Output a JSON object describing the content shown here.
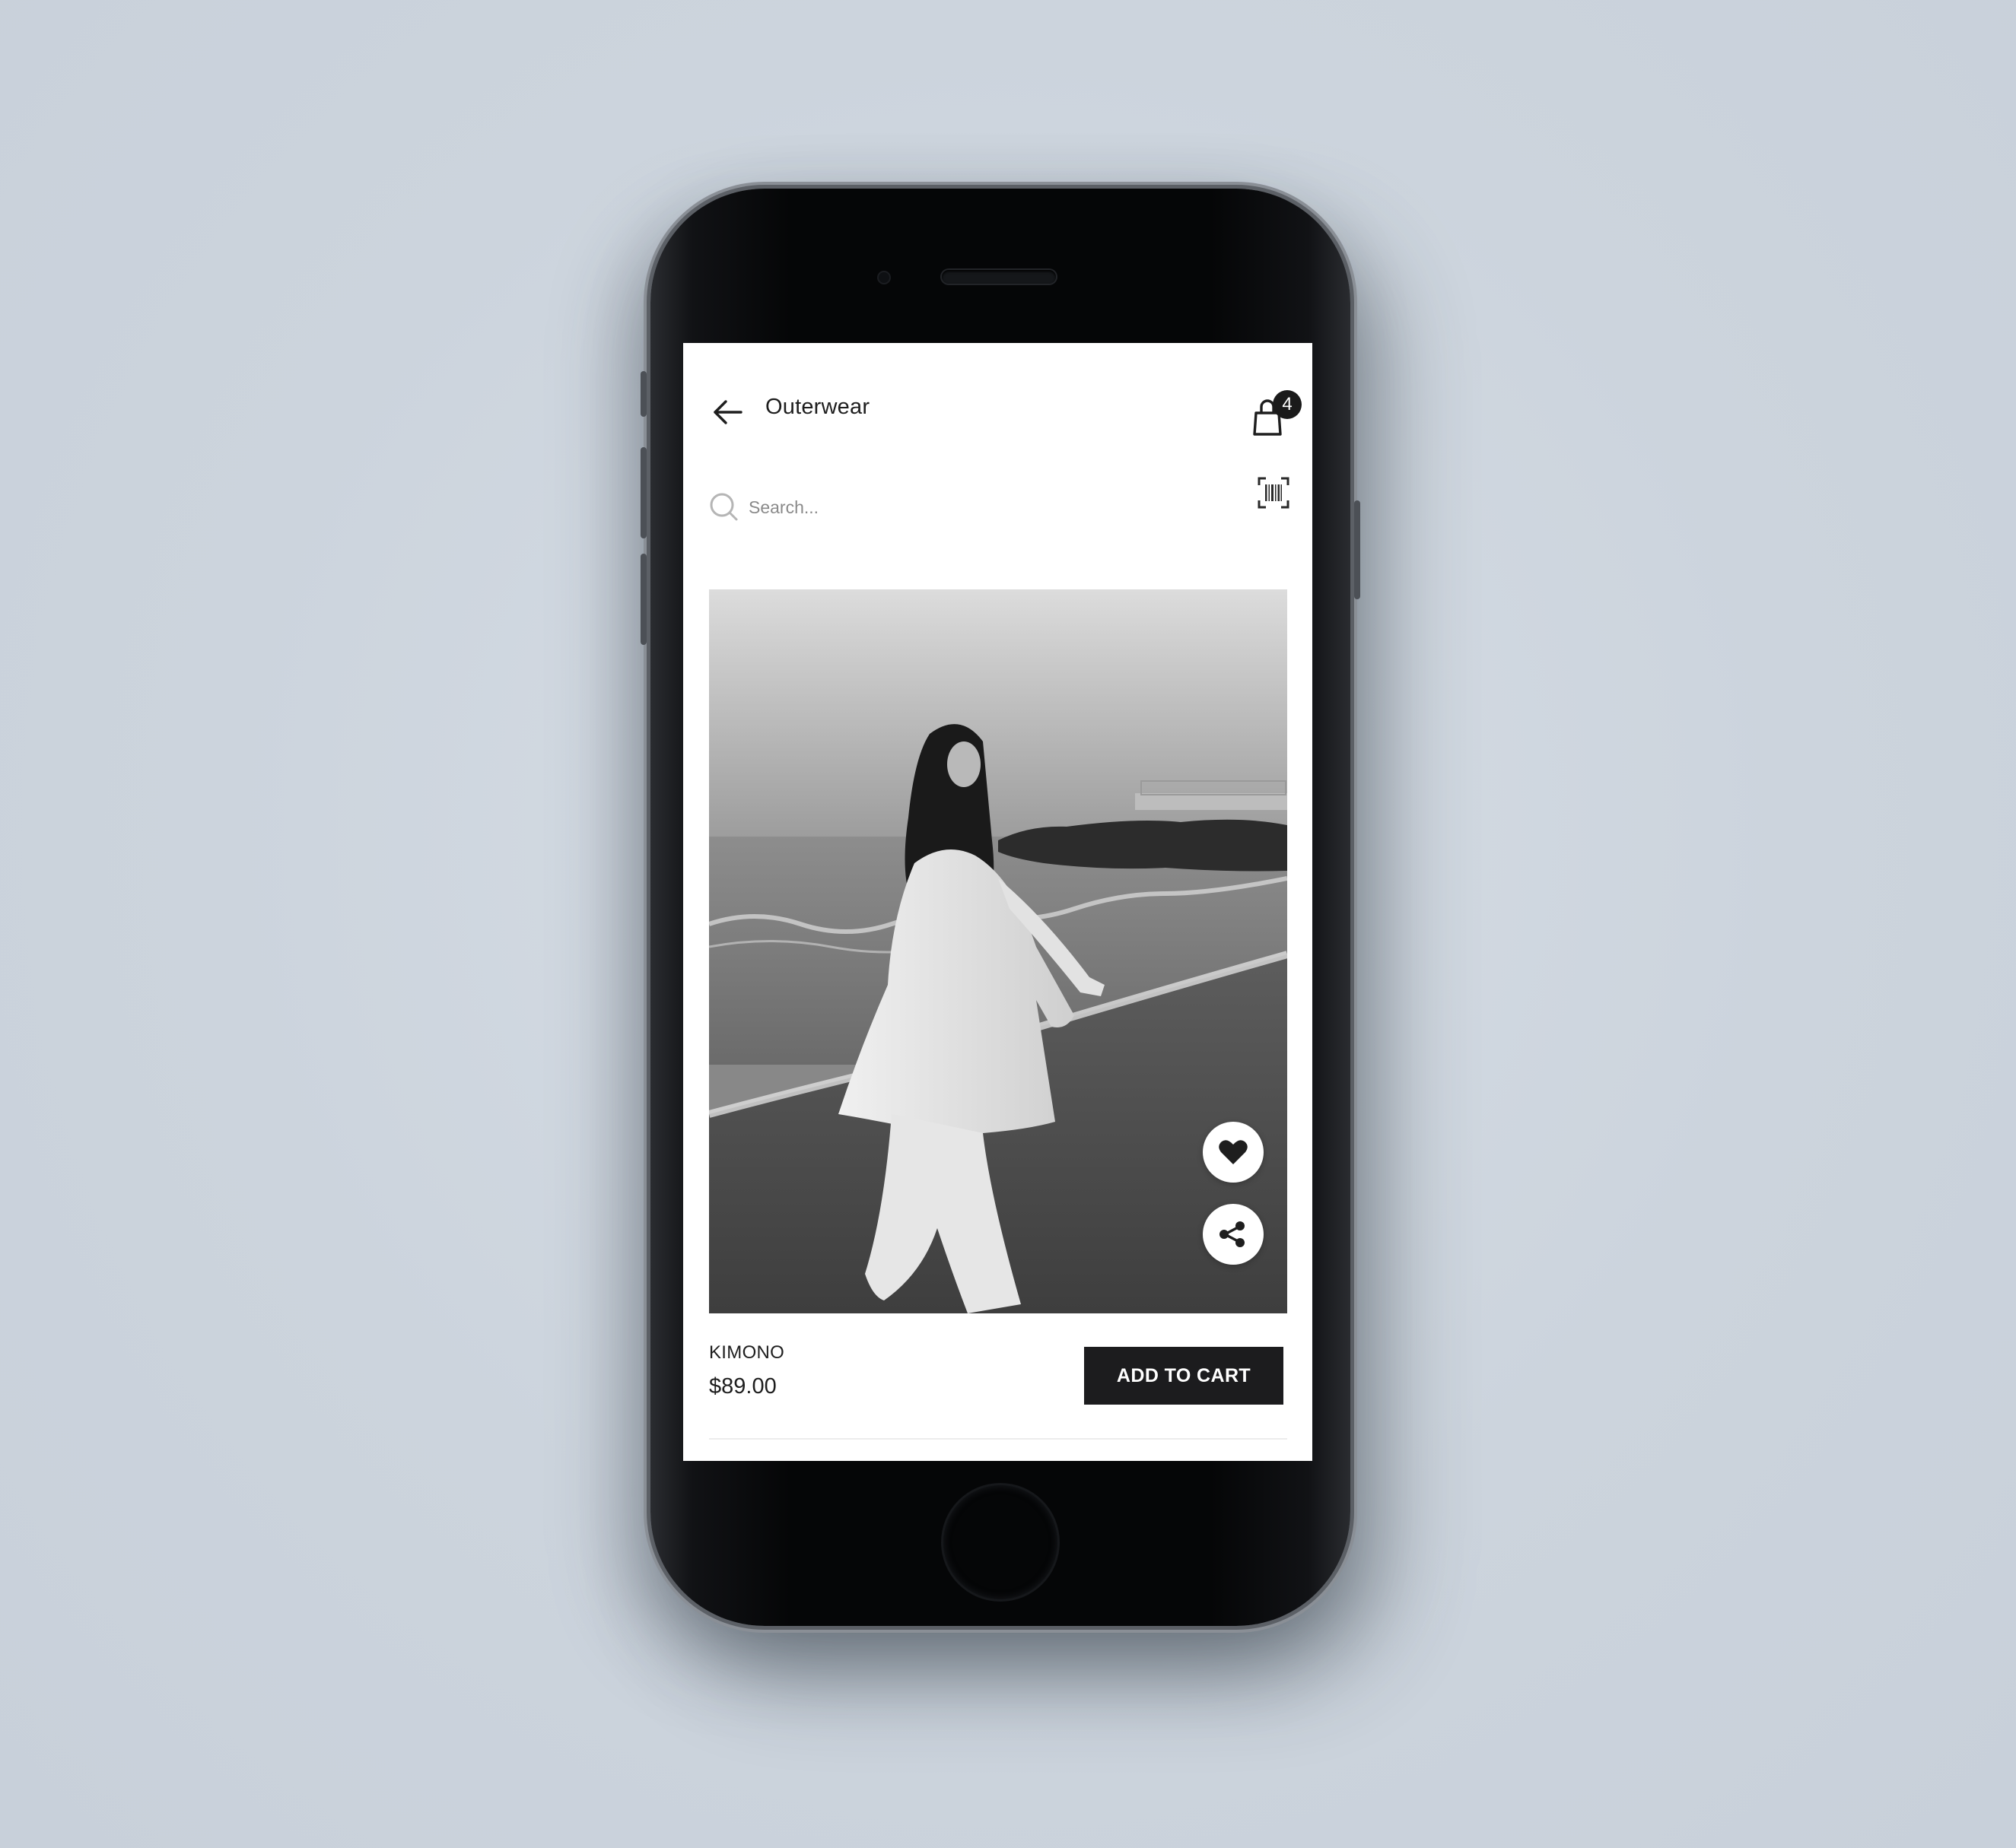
{
  "header": {
    "title": "Outerwear",
    "back_icon": "arrow-left-icon",
    "cart_icon": "shopping-bag-icon",
    "cart_count": "4"
  },
  "search": {
    "placeholder": "Search...",
    "value": "",
    "search_icon": "search-icon",
    "barcode_icon": "barcode-scan-icon"
  },
  "product": {
    "name": "KIMONO",
    "price": "$89.00",
    "add_to_cart_label": "ADD TO CART",
    "favorite_icon": "heart-icon",
    "share_icon": "share-icon",
    "image_description_hidden": ""
  },
  "colors": {
    "accent": "#1c1c1e",
    "screen_background": "#ffffff",
    "page_background": "#cdd5de"
  }
}
